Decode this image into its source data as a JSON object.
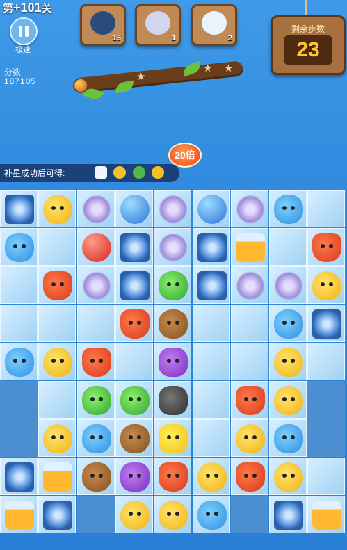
{
  "level": {
    "prefix": "第",
    "number": "+101",
    "suffix": "关"
  },
  "controls": {
    "speed_label": "极速"
  },
  "score": {
    "label": "分数",
    "value": "187105"
  },
  "targets": [
    {
      "icon": "penguin-icon",
      "count": "15",
      "color": "#2a4b7c"
    },
    {
      "icon": "seal-icon",
      "count": "1",
      "color": "#cfd6ee"
    },
    {
      "icon": "polar-bear-icon",
      "count": "2",
      "color": "#e9f4fb"
    }
  ],
  "moves": {
    "label": "剩余步数",
    "value": "23"
  },
  "bonus": {
    "multiplier": "20倍"
  },
  "reward": {
    "text": "补星成功后可得:"
  },
  "board": {
    "rows": [
      [
        "crystal",
        "chick",
        "flower",
        "bubble",
        "flower",
        "bubble",
        "flower",
        "hippo",
        "ice"
      ],
      [
        "hippo",
        "ice",
        "ball",
        "crystal",
        "flower",
        "crystal",
        "jar",
        "ice",
        "fox"
      ],
      [
        "ice",
        "fox",
        "flower",
        "crystal",
        "frog",
        "crystal",
        "flower",
        "flower",
        "chick"
      ],
      [
        "ice",
        "ice",
        "ice",
        "fox",
        "bear",
        "ice",
        "ice",
        "hippo",
        "crystal"
      ],
      [
        "hippo",
        "chick",
        "fox",
        "ice",
        "owl",
        "ice",
        "ice",
        "chick",
        "ice"
      ],
      [
        "mid",
        "ice",
        "frog",
        "frog",
        "one",
        "ice",
        "fox",
        "chick",
        "mid"
      ],
      [
        "mid",
        "chick",
        "hippo",
        "bear",
        "mon",
        "ice",
        "chick",
        "hippo",
        "mid"
      ],
      [
        "crystal",
        "jar",
        "bear",
        "owl",
        "fox",
        "chick",
        "fox",
        "chick",
        "ice"
      ],
      [
        "jar",
        "crystal",
        "mid",
        "chick",
        "chick",
        "hippo",
        "mid",
        "crystal",
        "jar"
      ]
    ]
  }
}
